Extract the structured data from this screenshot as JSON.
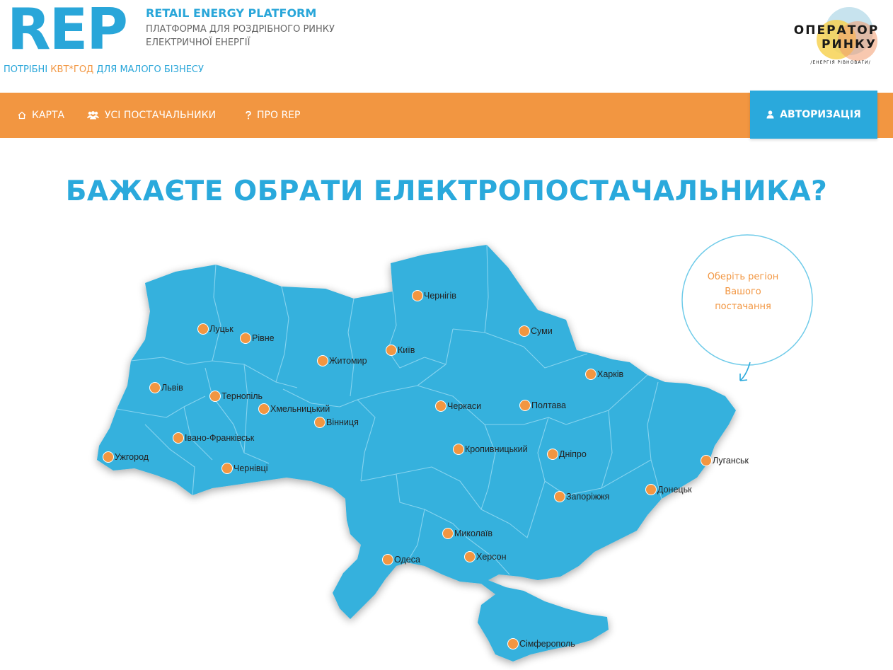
{
  "header": {
    "logo_text": "REP",
    "brand_title": "RETAIL ENERGY PLATFORM",
    "brand_sub_1": "ПЛАТФОРМА ДЛЯ РОЗДРІБНОГО РИНКУ",
    "brand_sub_2": "ЕЛЕКТРИЧНОЇ ЕНЕРГІЇ",
    "tagline_pre": "ПОТРІБНІ",
    "tagline_hl": "КВТ*ГОД",
    "tagline_post": "ДЛЯ МАЛОГО БІЗНЕСУ",
    "operator_logo_1": "ОПЕРАТОР",
    "operator_logo_2": "РИНКУ",
    "operator_logo_3": "/ЕНЕРГІЯ РІВНОВАГИ/"
  },
  "nav": {
    "items": [
      {
        "label": "КАРТА",
        "icon": "home-icon"
      },
      {
        "label": "УСІ ПОСТАЧАЛЬНИКИ",
        "icon": "users-icon"
      },
      {
        "label": "ПРО REP",
        "icon": "question-icon"
      }
    ],
    "auth_label": "АВТОРИЗАЦІЯ",
    "auth_icon": "user-icon"
  },
  "headline": "БАЖАЄТЕ ОБРАТИ ЕЛЕКТРОПОСТАЧАЛЬНИКА?",
  "hint": {
    "line1": "Оберіть регіон",
    "line2": "Вашого",
    "line3": "постачання"
  },
  "cities": [
    {
      "name": "Чернігів"
    },
    {
      "name": "Луцьк"
    },
    {
      "name": "Рівне"
    },
    {
      "name": "Київ"
    },
    {
      "name": "Суми"
    },
    {
      "name": "Житомир"
    },
    {
      "name": "Харків"
    },
    {
      "name": "Львів"
    },
    {
      "name": "Тернопіль"
    },
    {
      "name": "Хмельницький"
    },
    {
      "name": "Черкаси"
    },
    {
      "name": "Полтава"
    },
    {
      "name": "Вінниця"
    },
    {
      "name": "Івано-Франківськ"
    },
    {
      "name": "Кропивницький"
    },
    {
      "name": "Дніпро"
    },
    {
      "name": "Ужгород"
    },
    {
      "name": "Луганськ"
    },
    {
      "name": "Чернівці"
    },
    {
      "name": "Донецьк"
    },
    {
      "name": "Запоріжжя"
    },
    {
      "name": "Миколаїв"
    },
    {
      "name": "Одеса"
    },
    {
      "name": "Херсон"
    },
    {
      "name": "Сімферополь"
    }
  ],
  "colors": {
    "primary": "#2aa9dc",
    "accent": "#f29641",
    "map": "#35b1dd",
    "border": "#7fd0ee"
  }
}
